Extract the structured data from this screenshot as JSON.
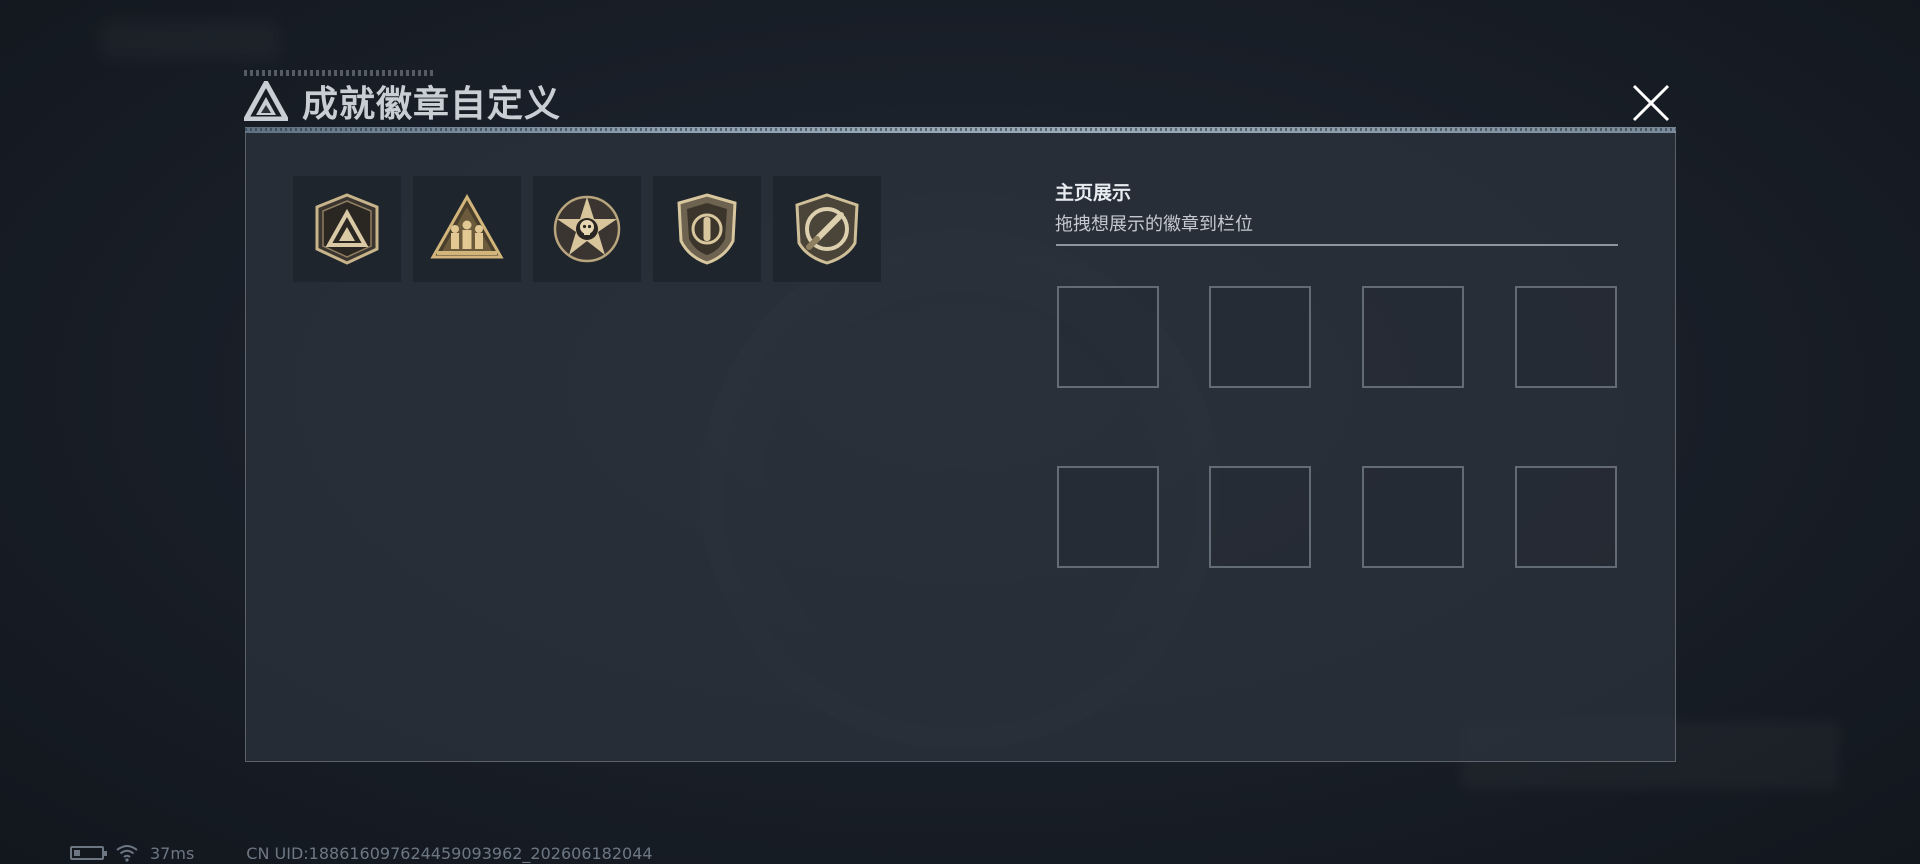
{
  "dialog": {
    "title": "成就徽章自定义",
    "close_icon": "close-icon"
  },
  "badges": [
    {
      "name": "badge-shield-triangle",
      "icon": "shield-triangle-icon"
    },
    {
      "name": "badge-triangle-soldiers",
      "icon": "triangle-soldiers-icon"
    },
    {
      "name": "badge-star-skull",
      "icon": "star-skull-icon"
    },
    {
      "name": "badge-shield-bullet",
      "icon": "shield-bullet-icon"
    },
    {
      "name": "badge-circle-knife",
      "icon": "circle-knife-icon"
    }
  ],
  "display": {
    "title": "主页展示",
    "subtitle": "拖拽想展示的徽章到栏位",
    "slot_count": 8
  },
  "status": {
    "ping": "37ms",
    "uid": "CN UID:1886160976244590939​62_202606182044"
  },
  "colors": {
    "badge_gold": "#c8b48a",
    "panel_bg": "#2c333d",
    "accent_bar": "#a9bfd0"
  }
}
